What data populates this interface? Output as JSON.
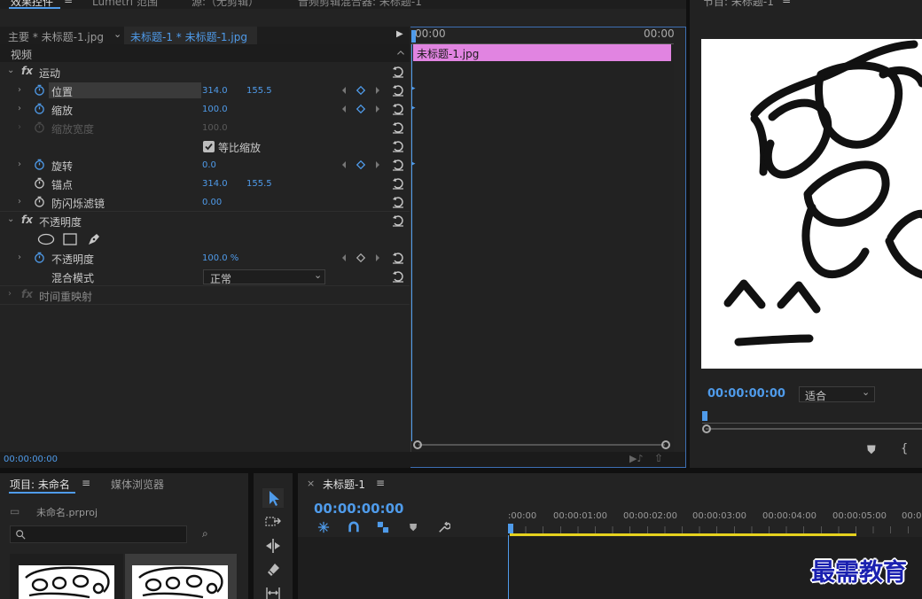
{
  "top_tabs": {
    "effect_controls": "效果控件",
    "lumetri": "Lumetri 范围",
    "source": "源:（无剪辑）",
    "audio_mixer": "音频剪辑混合器: 未标题-1",
    "program": "节目: 未标题-1"
  },
  "effect_controls": {
    "master_clip": "主要 * 未标题-1.jpg",
    "sequence_clip": "未标题-1 * 未标题-1.jpg",
    "section_video": "视频",
    "motion": "运动",
    "position": {
      "label": "位置",
      "x": "314.0",
      "y": "155.5"
    },
    "scale": {
      "label": "缩放",
      "value": "100.0"
    },
    "scale_width": {
      "label": "缩放宽度",
      "value": "100.0"
    },
    "uniform_scale": "等比缩放",
    "rotation": {
      "label": "旋转",
      "value": "0.0"
    },
    "anchor": {
      "label": "锚点",
      "x": "314.0",
      "y": "155.5"
    },
    "anti_flicker": {
      "label": "防闪烁滤镜",
      "value": "0.00"
    },
    "opacity_section": "不透明度",
    "opacity": {
      "label": "不透明度",
      "value": "100.0 %"
    },
    "blend_mode": {
      "label": "混合模式",
      "value": "正常"
    },
    "time_remap": "时间重映射",
    "timeline_start": "00:00",
    "timeline_end": "00:00",
    "clip_name": "未标题-1.jpg",
    "timecode": "00:00:00:00"
  },
  "program_monitor": {
    "timecode": "00:00:00:00",
    "fit": "适合"
  },
  "project": {
    "tab_project": "项目: 未命名",
    "tab_media_browser": "媒体浏览器",
    "file_name": "未命名.prproj"
  },
  "timeline": {
    "sequence_name": "未标题-1",
    "timecode": "00:00:00:00",
    "ruler": [
      ":00:00",
      "00:00:01:00",
      "00:00:02:00",
      "00:00:03:00",
      "00:00:04:00",
      "00:00:05:00",
      "00:0"
    ]
  },
  "watermark": "最需教育",
  "colors": {
    "accent_blue": "#4f9bea",
    "clip_pink": "#e184e1",
    "work_area_yellow": "#e6d21e",
    "panel_bg": "#232323"
  }
}
